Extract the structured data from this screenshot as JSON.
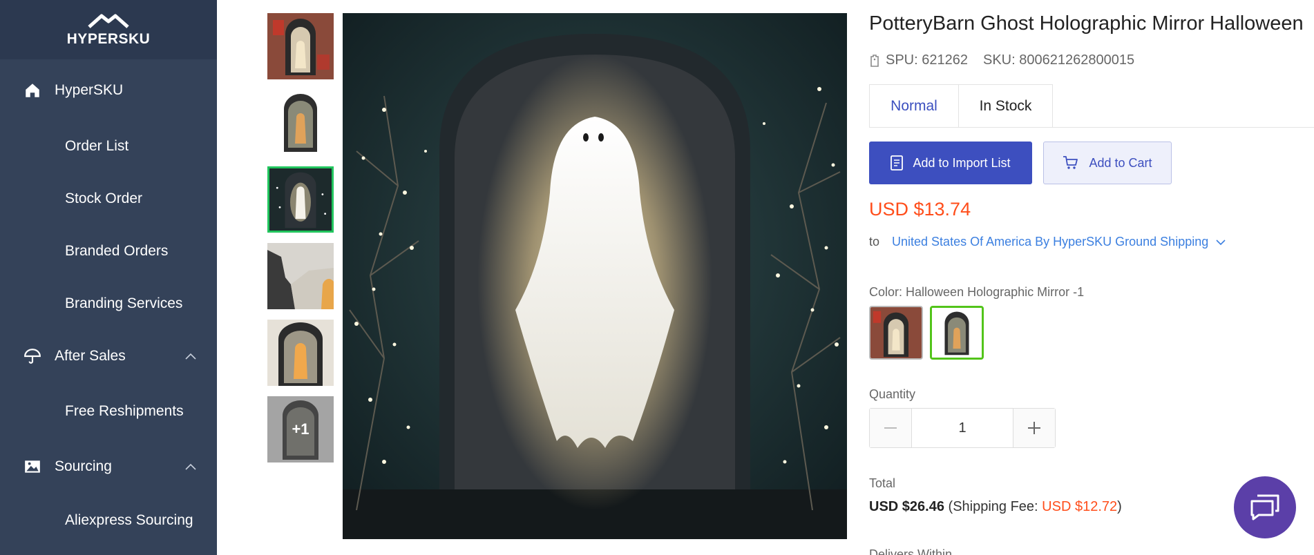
{
  "brand": {
    "logo_text": "HYPERSKU"
  },
  "sidebar": {
    "groups": [
      {
        "label": "HyperSKU",
        "icon": "home-icon"
      },
      {
        "label": "After Sales",
        "icon": "umbrella-icon"
      },
      {
        "label": "Sourcing",
        "icon": "image-icon"
      }
    ],
    "items": {
      "order_list": "Order List",
      "stock_order": "Stock Order",
      "branded_orders": "Branded Orders",
      "branding_services": "Branding Services",
      "free_reshipments": "Free Reshipments",
      "aliexpress_sourcing": "Aliexpress Sourcing"
    }
  },
  "gallery": {
    "more_count": "+1",
    "selected_index": 2
  },
  "product": {
    "title": "PotteryBarn Ghost Holographic Mirror Halloween",
    "spu": "SPU: 621262",
    "sku": "SKU: 800621262800015",
    "tabs": [
      "Normal",
      "In Stock"
    ],
    "add_import_label": "Add to Import List",
    "add_cart_label": "Add to Cart",
    "price": "USD $13.74",
    "ship_to_label": "to",
    "ship_method": "United States Of America By HyperSKU Ground Shipping",
    "color_label": "Color:",
    "color_value": "Halloween Holographic Mirror -1",
    "quantity_label": "Quantity",
    "quantity_value": "1",
    "total_label": "Total",
    "total_amount": "USD $26.46",
    "shipping_fee_label": "(Shipping Fee:",
    "shipping_fee_value": "USD $12.72",
    "shipping_fee_close": ")",
    "deliver_label": "Delivers Within"
  },
  "colors": {
    "sidebar_bg": "#344259",
    "primary": "#3d4fbf",
    "price": "#ff4d1a",
    "link": "#3b7fe0",
    "selected": "#22c55e",
    "chat": "#5b3fa8"
  }
}
